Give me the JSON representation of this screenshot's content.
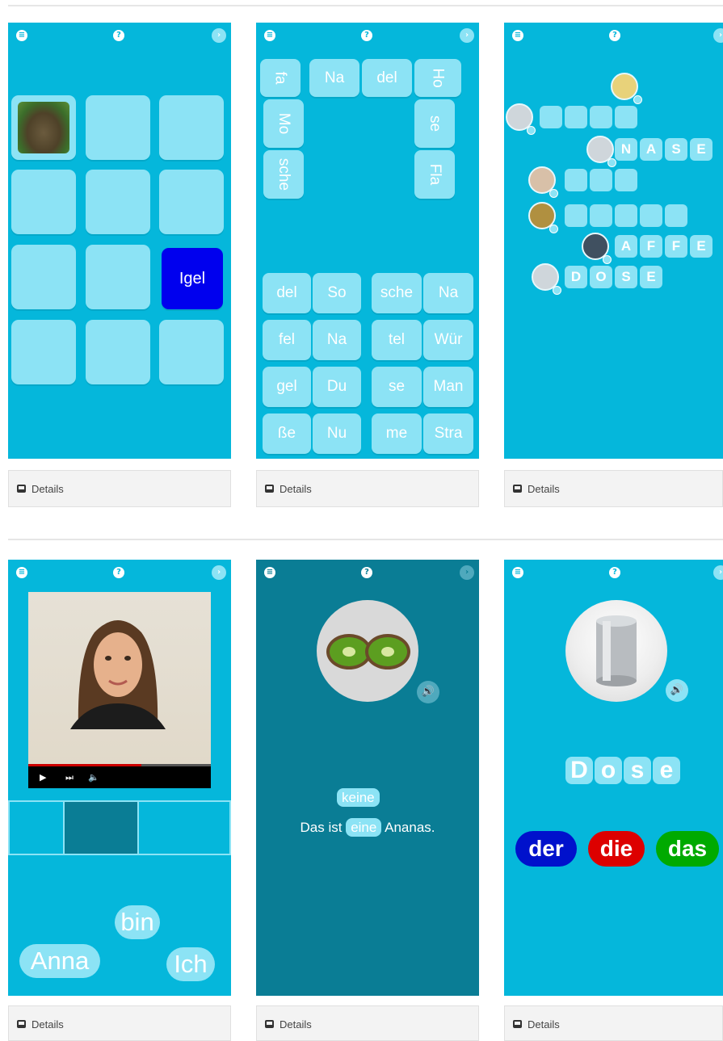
{
  "colors": {
    "screen_bg": "#05b7db",
    "screen_dark_bg": "#0a7d95",
    "tile": "#8ce3f5",
    "selected_tile": "#0000ee",
    "der": "#0011cc",
    "die": "#dd0000",
    "das": "#00aa00"
  },
  "details_label": "Details",
  "icons": {
    "menu": "menu-icon",
    "help": "help-icon",
    "next": "next-arrow-icon",
    "details": "details-icon",
    "speaker": "speaker-icon"
  },
  "card1": {
    "selected_word": "Igel",
    "image": "hedgehog"
  },
  "card2": {
    "top_vertical": [
      "fa",
      "Mo",
      "sche"
    ],
    "top_row": [
      "Na",
      "del"
    ],
    "right_vertical": [
      "Ho",
      "se",
      "Fla"
    ],
    "left_grid": [
      [
        "del",
        "So"
      ],
      [
        "fel",
        "Na"
      ],
      [
        "gel",
        "Du"
      ],
      [
        "ße",
        "Nu"
      ]
    ],
    "right_grid": [
      [
        "sche",
        "Na"
      ],
      [
        "tel",
        "Wür"
      ],
      [
        "se",
        "Man"
      ],
      [
        "me",
        "Stra"
      ]
    ]
  },
  "card3": {
    "word_nase": [
      "N",
      "A",
      "S",
      "E"
    ],
    "word_affe": [
      "A",
      "F",
      "F",
      "E"
    ],
    "word_dose": [
      "D",
      "O",
      "S",
      "E"
    ]
  },
  "card4": {
    "words": [
      "bin",
      "Anna",
      "Ich"
    ],
    "player": {
      "play": "▶",
      "next": "⏭",
      "volume": "🔈",
      "progress": 0.62
    }
  },
  "card5": {
    "option": "keine",
    "sentence_start": "Das ist",
    "chosen": "eine",
    "sentence_end": "Ananas."
  },
  "card6": {
    "letters": [
      "D",
      "o",
      "s",
      "e"
    ],
    "articles": [
      "der",
      "die",
      "das"
    ]
  }
}
